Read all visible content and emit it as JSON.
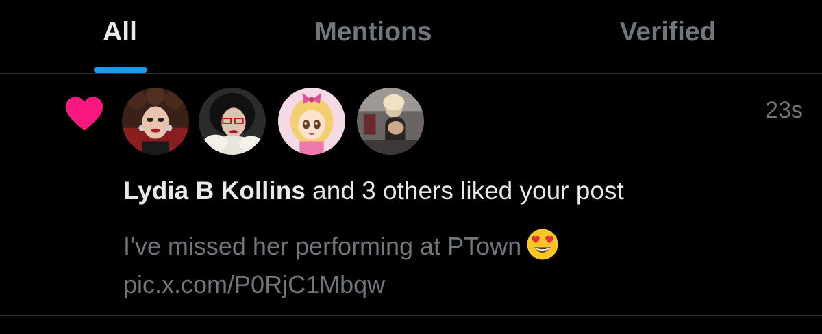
{
  "tabs": [
    {
      "label": "All",
      "active": true
    },
    {
      "label": "Mentions",
      "active": false
    },
    {
      "label": "Verified",
      "active": false
    }
  ],
  "accent_color": "#1d9bf0",
  "like_color": "#f91880",
  "notification": {
    "type": "like",
    "icon": "heart-icon",
    "timestamp": "23s",
    "actor_name": "Lydia B Kollins",
    "summary_rest": " and 3 others liked your post",
    "post_text": "I've missed her performing at PTown",
    "post_emoji": "heart-eyes-emoji",
    "post_link": "pic.x.com/P0RjC1Mbqw",
    "avatar_count": 4
  }
}
